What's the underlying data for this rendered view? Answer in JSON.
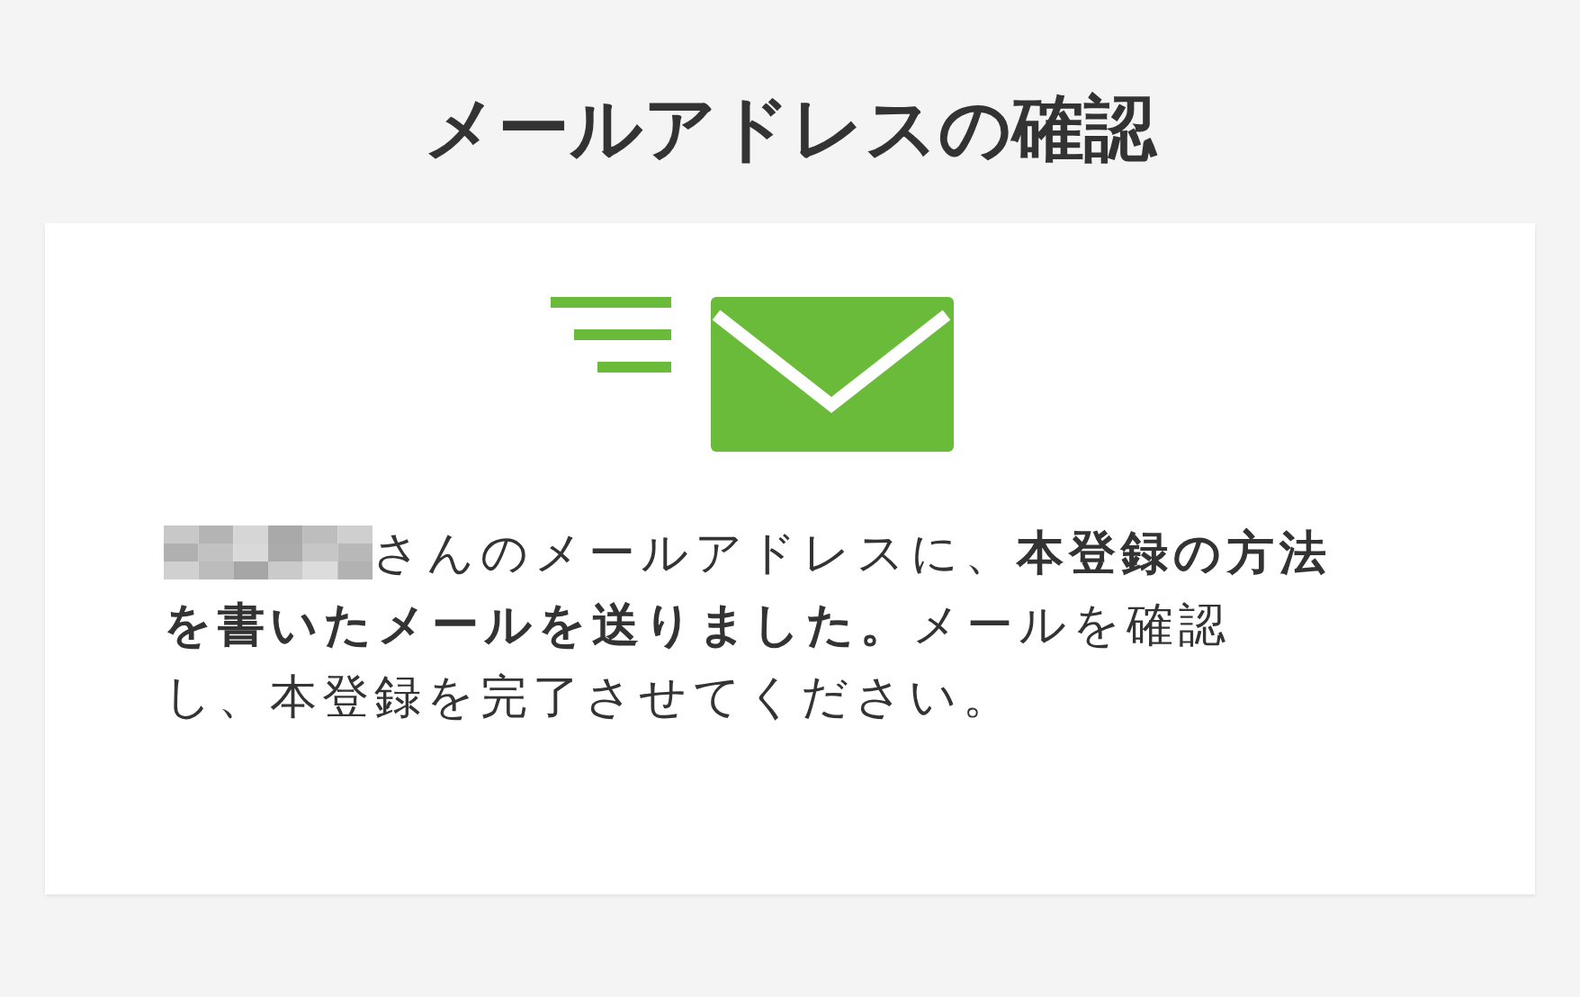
{
  "title": "メールアドレスの確認",
  "message_first_line": "さんのメールアドレスに、**本登録の方法**",
  "message_rest": "**を書いたメールを送りました。**メールを確認し、本登録を完了させてください。"
}
